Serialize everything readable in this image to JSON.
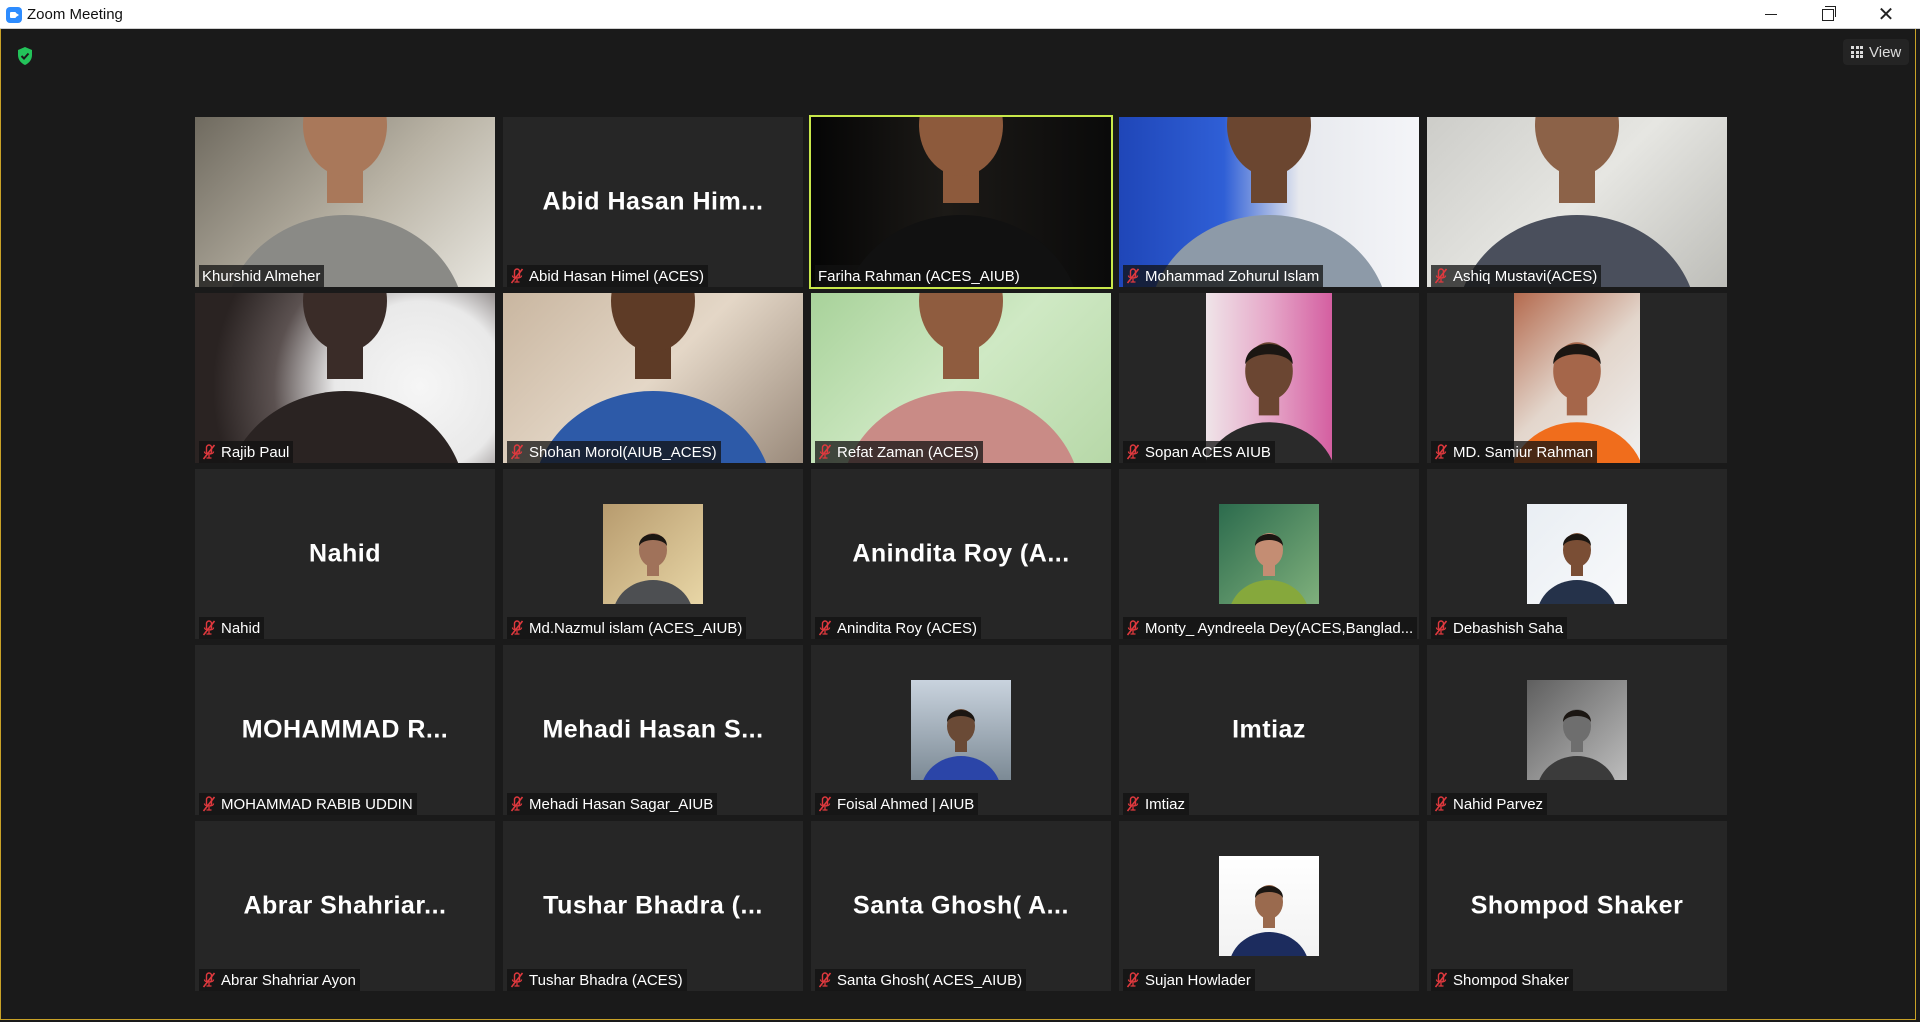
{
  "window": {
    "title": "Zoom Meeting"
  },
  "toolbar": {
    "view_label": "View"
  },
  "colors": {
    "active_speaker_border": "#c8e84a",
    "muted_icon": "#e0393e",
    "background": "#1a1a1a",
    "tile": "#262626"
  },
  "tiles": [
    {
      "label": "Khurshid Almeher",
      "display": "",
      "muted": false,
      "kind": "video"
    },
    {
      "label": "Abid Hasan Himel (ACES)",
      "display": "Abid Hasan Him...",
      "muted": true,
      "kind": "name"
    },
    {
      "label": "Fariha Rahman (ACES_AIUB)",
      "display": "",
      "muted": false,
      "kind": "video",
      "active": true
    },
    {
      "label": "Mohammad Zohurul Islam",
      "display": "",
      "muted": true,
      "kind": "video"
    },
    {
      "label": "Ashiq Mustavi(ACES)",
      "display": "",
      "muted": true,
      "kind": "video"
    },
    {
      "label": "Rajib Paul",
      "display": "",
      "muted": true,
      "kind": "video"
    },
    {
      "label": "Shohan Morol(AIUB_ACES)",
      "display": "",
      "muted": true,
      "kind": "video"
    },
    {
      "label": "Refat Zaman (ACES)",
      "display": "",
      "muted": true,
      "kind": "video"
    },
    {
      "label": "Sopan ACES AIUB",
      "display": "",
      "muted": true,
      "kind": "portrait"
    },
    {
      "label": "MD. Samiur Rahman",
      "display": "",
      "muted": true,
      "kind": "portrait"
    },
    {
      "label": "Nahid",
      "display": "Nahid",
      "muted": true,
      "kind": "name"
    },
    {
      "label": "Md.Nazmul islam (ACES_AIUB)",
      "display": "",
      "muted": true,
      "kind": "photo"
    },
    {
      "label": "Anindita Roy (ACES)",
      "display": "Anindita Roy (A...",
      "muted": true,
      "kind": "name"
    },
    {
      "label": "Monty_ Ayndreela Dey(ACES,Banglad...",
      "display": "",
      "muted": true,
      "kind": "photo"
    },
    {
      "label": "Debashish Saha",
      "display": "",
      "muted": true,
      "kind": "photo"
    },
    {
      "label": "MOHAMMAD RABIB UDDIN",
      "display": "MOHAMMAD R...",
      "muted": true,
      "kind": "name"
    },
    {
      "label": "Mehadi Hasan Sagar_AIUB",
      "display": "Mehadi Hasan S...",
      "muted": true,
      "kind": "name"
    },
    {
      "label": "Foisal Ahmed | AIUB",
      "display": "",
      "muted": true,
      "kind": "photo"
    },
    {
      "label": "Imtiaz",
      "display": "Imtiaz",
      "muted": true,
      "kind": "name"
    },
    {
      "label": "Nahid Parvez",
      "display": "",
      "muted": true,
      "kind": "photo"
    },
    {
      "label": "Abrar Shahriar Ayon",
      "display": "Abrar Shahriar...",
      "muted": true,
      "kind": "name"
    },
    {
      "label": "Tushar Bhadra (ACES)",
      "display": "Tushar Bhadra (...",
      "muted": true,
      "kind": "name"
    },
    {
      "label": "Santa Ghosh( ACES_AIUB)",
      "display": "Santa Ghosh( A...",
      "muted": true,
      "kind": "name"
    },
    {
      "label": "Sujan Howlader",
      "display": "",
      "muted": true,
      "kind": "photo"
    },
    {
      "label": "Shompod Shaker",
      "display": "Shompod Shaker",
      "muted": true,
      "kind": "name"
    }
  ]
}
